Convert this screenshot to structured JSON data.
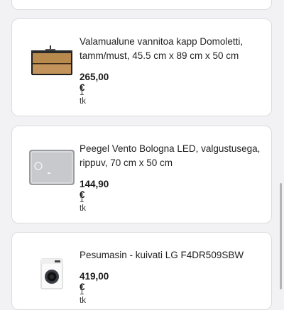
{
  "cart": {
    "items": [
      {
        "title": "Valamualune vannitoa kapp Domoletti, tamm/must, 45.5 cm x 89 cm x 50 cm",
        "price": "265,00 €",
        "qty": "1 tk",
        "image_icon": "vanity-cabinet-icon"
      },
      {
        "title": "Peegel Vento Bologna LED, valgustusega, rippuv, 70 cm x 50 cm",
        "price": "144,90 €",
        "qty": "1 tk",
        "image_icon": "led-mirror-icon"
      },
      {
        "title": "Pesumasin - kuivati LG F4DR509SBW",
        "price": "419,00 €",
        "qty": "1 tk",
        "image_icon": "washing-machine-icon"
      }
    ]
  },
  "colors": {
    "background": "#f2f2f4",
    "card": "#ffffff",
    "card_border": "#dcdce0",
    "text": "#1a1a1a"
  }
}
